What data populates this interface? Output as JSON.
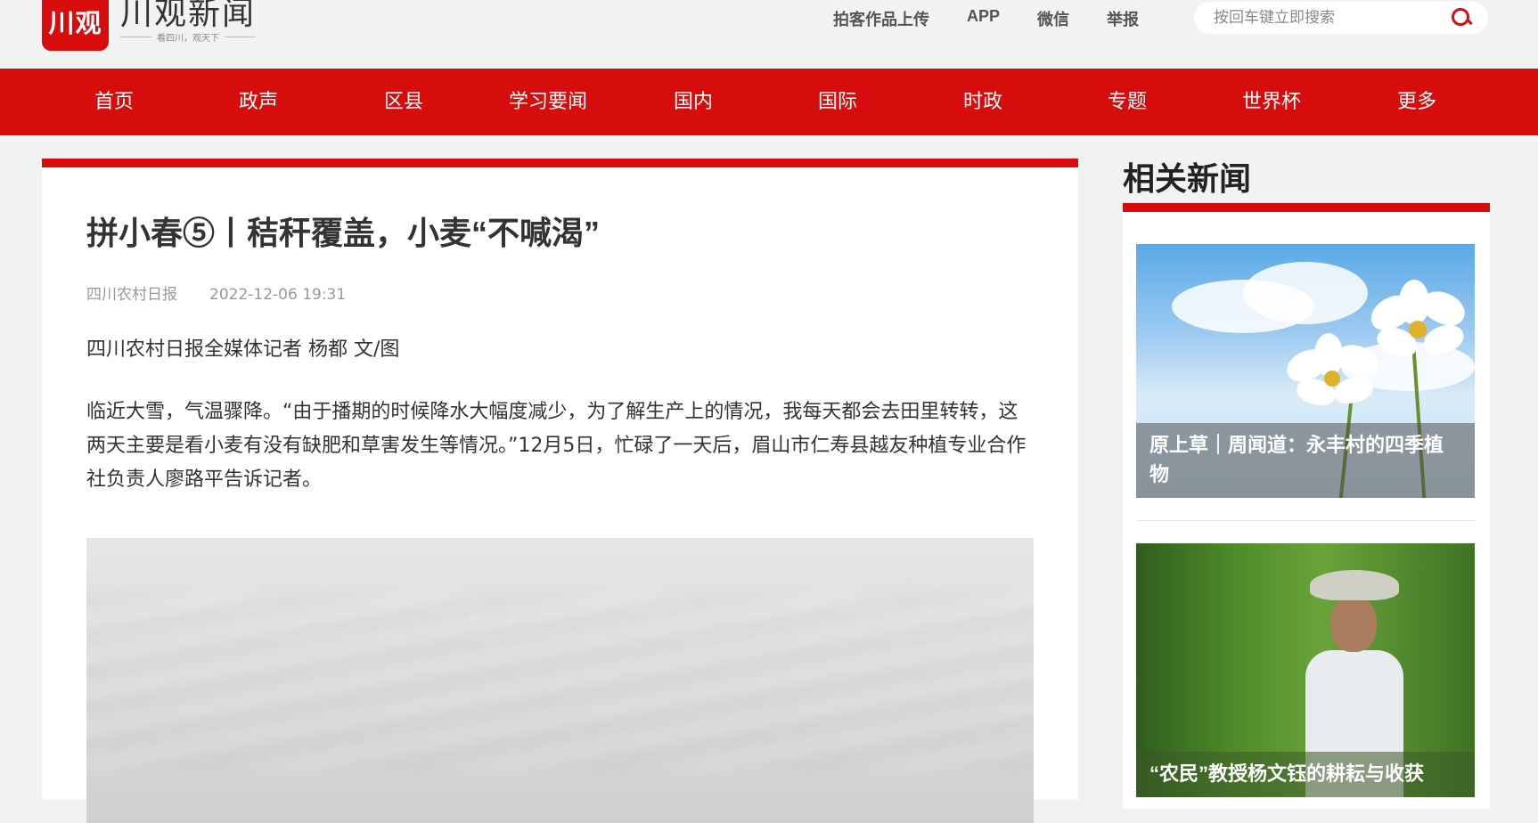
{
  "header": {
    "logo_mark": "川观",
    "logo_name": "川观新闻",
    "slogan": "看四川，观天下",
    "links": [
      "拍客作品上传",
      "APP",
      "微信",
      "举报"
    ],
    "search_placeholder": "按回车键立即搜索"
  },
  "nav": {
    "items": [
      "首页",
      "政声",
      "区县",
      "学习要闻",
      "国内",
      "国际",
      "时政",
      "专题",
      "世界杯",
      "更多"
    ]
  },
  "article": {
    "title": "拼小春⑤丨秸秆覆盖，小麦“不喊渴”",
    "source": "四川农村日报",
    "date": "2022-12-06 19:31",
    "byline": "四川农村日报全媒体记者 杨都 文/图",
    "paragraph": "临近大雪，气温骤降。“由于播期的时候降水大幅度减少，为了解生产上的情况，我每天都会去田里转转，这两天主要是看小麦有没有缺肥和草害发生等情况。”12月5日，忙碌了一天后，眉山市仁寿县越友种植专业合作社负责人廖路平告诉记者。"
  },
  "sidebar": {
    "heading": "相关新闻",
    "items": [
      {
        "caption": "原上草｜周闻道：永丰村的四季植物"
      },
      {
        "caption": "“农民”教授杨文钰的耕耘与收获"
      }
    ]
  },
  "colors": {
    "brand_red": "#d70d0d",
    "page_bg": "#f2f2f2"
  }
}
